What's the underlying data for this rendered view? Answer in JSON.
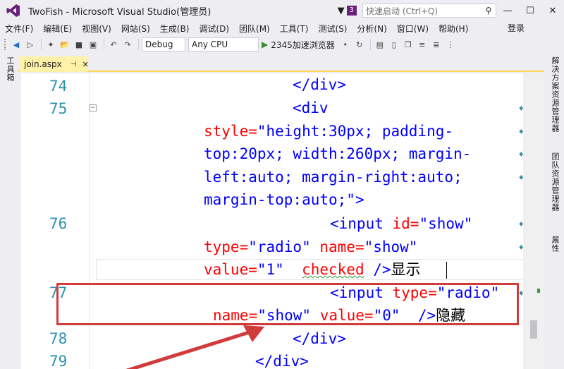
{
  "window": {
    "title": "TwoFish - Microsoft Visual Studio(管理员)",
    "notification_count": "3",
    "quick_launch_placeholder": "快速启动 (Ctrl+Q)",
    "login": "登录"
  },
  "menu": [
    "文件(F)",
    "编辑(E)",
    "视图(V)",
    "网站(S)",
    "生成(B)",
    "调试(D)",
    "团队(M)",
    "工具(T)",
    "测试(S)",
    "分析(N)",
    "窗口(W)",
    "帮助(H)"
  ],
  "toolbar": {
    "config": "Debug",
    "platform": "Any CPU",
    "run_target": "2345加速浏览器"
  },
  "left_rail": {
    "toolbox": "工具箱"
  },
  "right_rail": {
    "solution_explorer": "解决方案资源管理器",
    "team_explorer": "团队资源管理器",
    "properties": "属性"
  },
  "doc_tab": {
    "name": "join.aspx"
  },
  "code": {
    "ln74": "74",
    "ln75": "75",
    "ln76": "76",
    "ln77": "77",
    "ln78": "78",
    "ln79": "79",
    "l74": "</div>",
    "l75a": "<div",
    "l75b_attr": "style=",
    "l75b_val": "\"height:30px; padding-",
    "l75c": "top:20px; width:260px; margin-",
    "l75d": "left:auto; margin-right:auto;",
    "l75e_val": "margin-top:auto;\"",
    "l75e_close": ">",
    "l76a_open": "<input",
    "l76a_attr": " id=",
    "l76a_val": "\"show\"",
    "l76b_attr1": "type=",
    "l76b_val1": "\"radio\"",
    "l76b_attr2": " name=",
    "l76b_val2": "\"show\"",
    "l76c_attr": "value=",
    "l76c_val": "\"1\"",
    "l76c_checked": "checked",
    "l76c_close": " />",
    "l76c_text": "显示",
    "l77a_open": "<input",
    "l77a_attr": " type=",
    "l77a_val": "\"radio\"",
    "l77b_attr1": "name=",
    "l77b_val1": "\"show\"",
    "l77b_attr2": " value=",
    "l77b_val2": "\"0\"",
    "l77b_close": "  />",
    "l77b_text": "隐藏",
    "l78": "</div>",
    "l79": "</div>"
  }
}
